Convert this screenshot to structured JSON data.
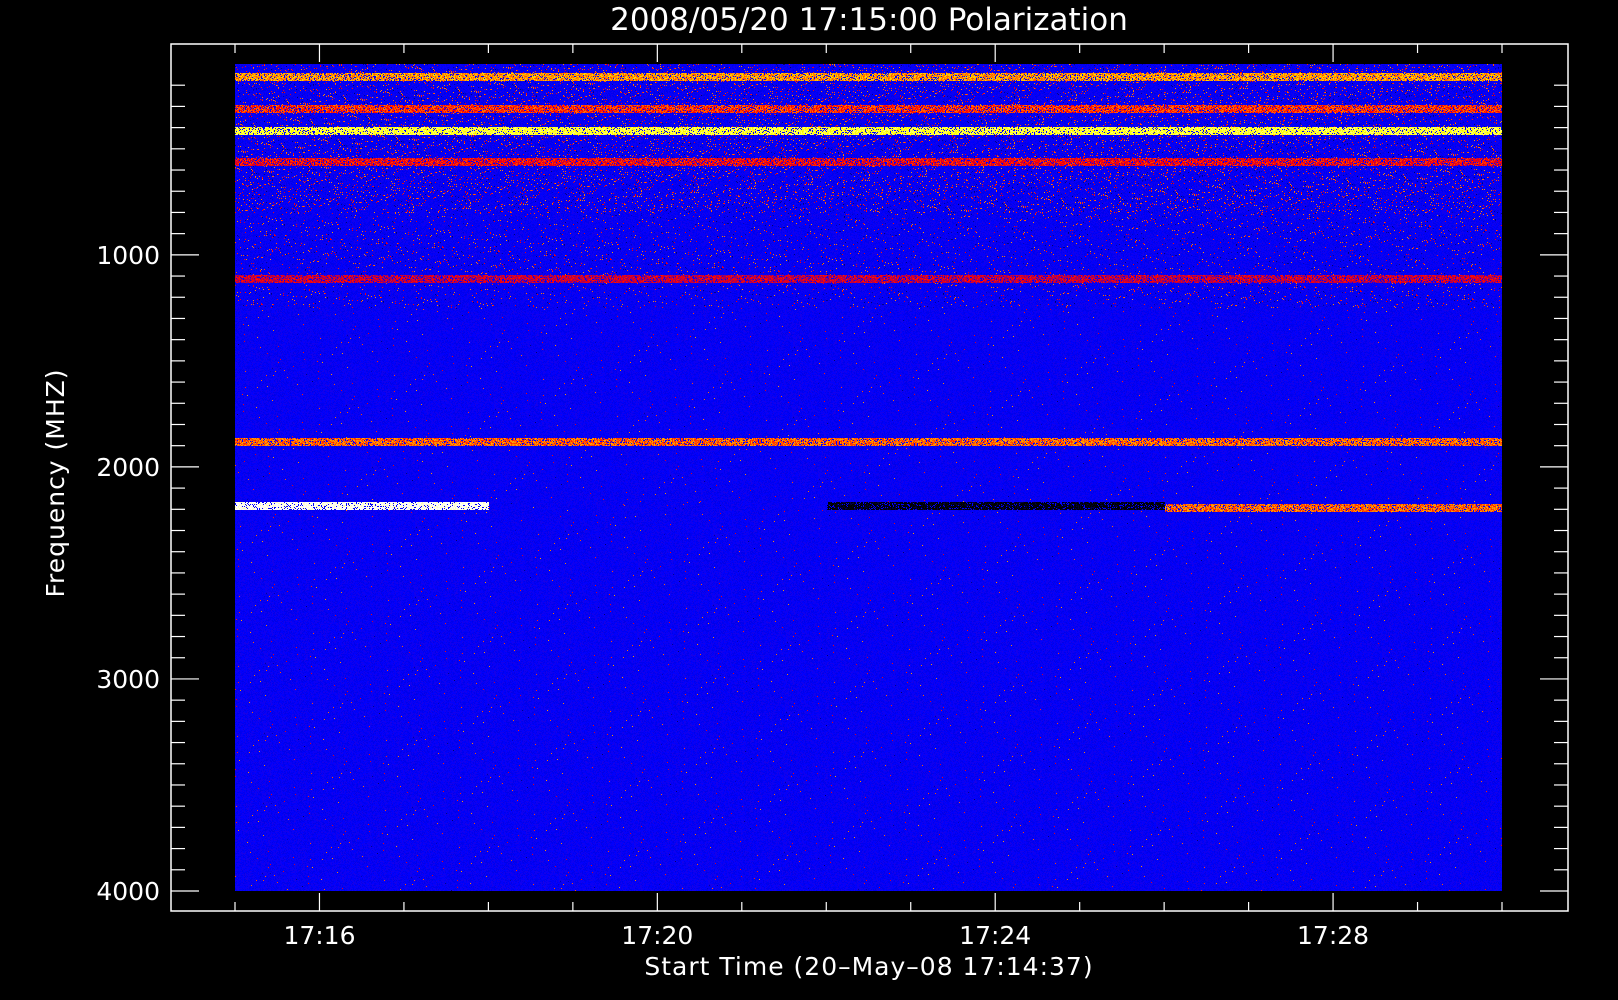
{
  "chart_data": {
    "type": "heatmap",
    "title": "2008/05/20 17:15:00 Polarization",
    "xlabel": "Start Time (20–May–08 17:14:37)",
    "ylabel": "Frequency (MHZ)",
    "x_range_minutes": [
      "17:15",
      "17:30"
    ],
    "y_range_mhz": [
      100,
      4000
    ],
    "y_axis_inverted": true,
    "x_major_ticks": [
      "17:16",
      "17:20",
      "17:24",
      "17:28"
    ],
    "y_major_ticks": [
      "1000",
      "2000",
      "3000",
      "4000"
    ],
    "colormap": [
      "#000000",
      "#0000ff",
      "#ff0000",
      "#ffff00",
      "#ffffff"
    ],
    "background_color": "#0000ff",
    "features": [
      {
        "freq_mhz": 160,
        "t_start": "17:15",
        "t_end": "17:30",
        "level": 0.65
      },
      {
        "freq_mhz": 310,
        "t_start": "17:15",
        "t_end": "17:30",
        "level": 0.55
      },
      {
        "freq_mhz": 415,
        "t_start": "17:15",
        "t_end": "17:30",
        "level": 0.8
      },
      {
        "freq_mhz": 560,
        "t_start": "17:15",
        "t_end": "17:30",
        "level": 0.5
      },
      {
        "freq_mhz": 1110,
        "t_start": "17:15",
        "t_end": "17:30",
        "level": 0.45
      },
      {
        "freq_mhz": 1880,
        "t_start": "17:15",
        "t_end": "17:30",
        "level": 0.6
      },
      {
        "freq_mhz": 2180,
        "t_start": "17:15",
        "t_end": "17:18",
        "level": 1.0
      },
      {
        "freq_mhz": 2180,
        "t_start": "17:22",
        "t_end": "17:26",
        "level": 0.0
      },
      {
        "freq_mhz": 2190,
        "t_start": "17:26",
        "t_end": "17:30",
        "level": 0.6
      }
    ]
  }
}
